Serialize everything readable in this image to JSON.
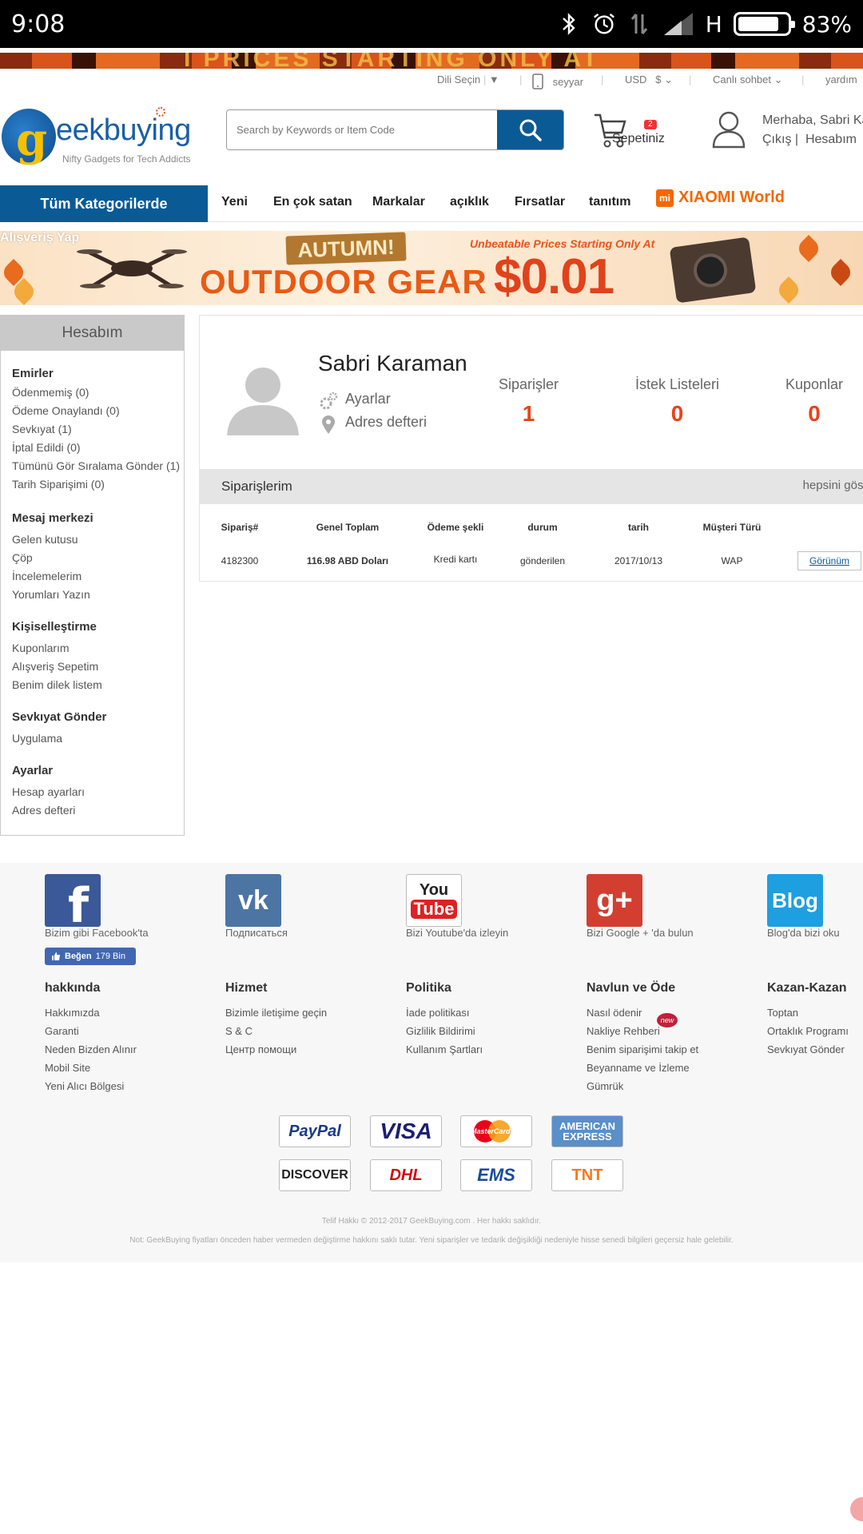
{
  "status_bar": {
    "time": "9:08",
    "network": "H",
    "battery": "83%",
    "battery_level": 0.83
  },
  "promo_strip": {
    "text": "I PRICES STARTING ONLY AT"
  },
  "utility_bar": {
    "language": "Dili Seçin",
    "language_arrow": "▼",
    "mobile": "seyyar",
    "currency": "USD",
    "currency_symbol": "$",
    "chat": "Canlı sohbet",
    "help": "yardım"
  },
  "header": {
    "logo_text": "eekbuying",
    "logo_g": "g",
    "logo_tagline": "Nifty Gadgets for Tech Addicts",
    "search_placeholder": "Search by Keywords or Item Code",
    "cart_count": "2",
    "cart_label": "Sepetiniz",
    "greeting": "Merhaba, Sabri Ka",
    "logout": "Çıkış",
    "account": "Hesabım"
  },
  "nav": {
    "all_categories": "Tüm Kategorilerde",
    "items": [
      "Yeni",
      "En çok satan",
      "Markalar",
      "açıklık",
      "Fırsatlar",
      "tanıtım"
    ],
    "xiaomi_logo": "mi",
    "xiaomi": "XIAOMI World"
  },
  "banner": {
    "shop_label": "Alışveriş Yap",
    "autumn": "AUTUMN!",
    "title": "OUTDOOR GEAR",
    "subtitle": "Unbeatable Prices Starting Only At",
    "price": "$0.01"
  },
  "sidebar": {
    "title": "Hesabım",
    "sections": [
      {
        "title": "Emirler",
        "links": [
          "Ödenmemiş (0)",
          "Ödeme Onaylandı (0)",
          "Sevkıyat (1)",
          "İptal Edildi (0)",
          "Tümünü Gör Sıralama Gönder (1)",
          "Tarih Siparişimi (0)"
        ]
      },
      {
        "title": "Mesaj merkezi",
        "links": [
          "Gelen kutusu",
          "Çöp",
          "İncelemelerim",
          "Yorumları Yazın"
        ]
      },
      {
        "title": "Kişiselleştirme",
        "links": [
          "Kuponlarım",
          "Alışveriş Sepetim",
          "Benim dilek listem"
        ]
      },
      {
        "title": "Sevkıyat Gönder",
        "links": [
          "Uygulama"
        ]
      },
      {
        "title": "Ayarlar",
        "links": [
          "Hesap ayarları",
          "Adres defteri"
        ]
      }
    ]
  },
  "profile": {
    "name": "Sabri Karaman",
    "settings": "Ayarlar",
    "address_book": "Adres defteri",
    "stats": [
      {
        "label": "Siparişler",
        "value": "1"
      },
      {
        "label": "İstek Listeleri",
        "value": "0"
      },
      {
        "label": "Kuponlar",
        "value": "0"
      }
    ]
  },
  "orders": {
    "title": "Siparişlerim",
    "show_all": "hepsini göste",
    "columns": [
      "Sipariş#",
      "Genel Toplam",
      "Ödeme şekli",
      "durum",
      "tarih",
      "Müşteri Türü"
    ],
    "rows": [
      {
        "order_no": "4182300",
        "total": "116.98 ABD Doları",
        "payment": "Kredi kartı",
        "status": "gönderilen",
        "date": "2017/10/13",
        "customer_type": "WAP",
        "action": "Görünüm"
      }
    ]
  },
  "footer": {
    "social": [
      {
        "icon": "facebook-icon",
        "glyph": "f",
        "caption": "Bizim gibi Facebook'ta",
        "color": "#3b5998"
      },
      {
        "icon": "vk-icon",
        "glyph": "vk",
        "caption": "Подписаться",
        "color": "#4c75a3"
      },
      {
        "icon": "youtube-icon",
        "glyph": "You",
        "glyph2": "Tube",
        "caption": "Bizi Youtube'da izleyin",
        "color": "#ffffff"
      },
      {
        "icon": "google-plus-icon",
        "glyph": "g+",
        "caption": "Bizi Google + 'da bulun",
        "color": "#d23f31"
      },
      {
        "icon": "blog-icon",
        "glyph": "Blog",
        "caption": "Blog'da bizi oku",
        "color": "#1e9fe0"
      }
    ],
    "like_button": "Beğen",
    "like_count": "179 Bin",
    "columns": [
      {
        "title": "hakkında",
        "links": [
          "Hakkımızda",
          "Garanti",
          "Neden Bizden Alınır",
          "Mobil Site",
          "Yeni Alıcı Bölgesi"
        ]
      },
      {
        "title": "Hizmet",
        "links": [
          "Bizimle iletişime geçin",
          "S & C",
          "Центр помощи"
        ]
      },
      {
        "title": "Politika",
        "links": [
          "İade politikası",
          "Gizlilik Bildirimi",
          "Kullanım Şartları"
        ]
      },
      {
        "title": "Navlun ve Öde",
        "links": [
          "Nasıl ödenir",
          "Nakliye Rehberi",
          "Benim siparişimi takip et",
          "Beyanname ve İzleme",
          "Gümrük"
        ]
      },
      {
        "title": "Kazan-Kazan",
        "links": [
          "Toptan",
          "Ortaklık Programı",
          "Sevkıyat Gönder"
        ]
      }
    ],
    "new_badge": "new",
    "payments": [
      "PayPal",
      "VISA",
      "MasterCard",
      "AMERICAN EXPRESS",
      "DISCOVER",
      "DHL",
      "EMS",
      "TNT"
    ],
    "copyright": "Telif Hakkı © 2012-2017 GeekBuying.com . Her hakkı saklıdır.",
    "note": "Not: GeekBuying fiyatları önceden haber vermeden değiştirme hakkını saklı tutar. Yeni siparişler ve tedarik değişikliği nedeniyle hisse senedi bilgileri geçersiz hale gelebilir."
  }
}
